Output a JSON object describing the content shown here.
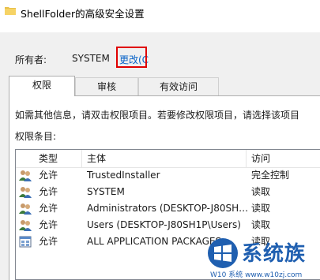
{
  "window": {
    "title": "ShellFolder的高级安全设置"
  },
  "owner": {
    "label": "所有者:",
    "value": "SYSTEM",
    "change_link": "更改(C"
  },
  "tabs": [
    {
      "label": "权限",
      "active": true
    },
    {
      "label": "审核",
      "active": false
    },
    {
      "label": "有效访问",
      "active": false
    }
  ],
  "info_text": "如需其他信息，请双击权限项目。若要修改权限项目，请选择该项目",
  "entries_label": "权限条目:",
  "table": {
    "headers": [
      "类型",
      "主体",
      "访问"
    ],
    "rows": [
      {
        "icon": "users-icon",
        "type": "允许",
        "principal": "TrustedInstaller",
        "access": "完全控制"
      },
      {
        "icon": "users-icon",
        "type": "允许",
        "principal": "SYSTEM",
        "access": "读取"
      },
      {
        "icon": "users-icon",
        "type": "允许",
        "principal": "Administrators (DESKTOP-J80SH…",
        "access": "读取"
      },
      {
        "icon": "users-icon",
        "type": "允许",
        "principal": "Users (DESKTOP-J80SH1P\\Users)",
        "access": "读取"
      },
      {
        "icon": "app-packages-icon",
        "type": "允许",
        "principal": "ALL APPLICATION PACKAGES",
        "access": "读取"
      }
    ]
  },
  "watermark": {
    "text": "系统族",
    "sub": "W10 系统 www.w10zj.com"
  },
  "colors": {
    "highlight": "#e00000",
    "link": "#0a64c8",
    "watermark": "#1f5fb0"
  }
}
